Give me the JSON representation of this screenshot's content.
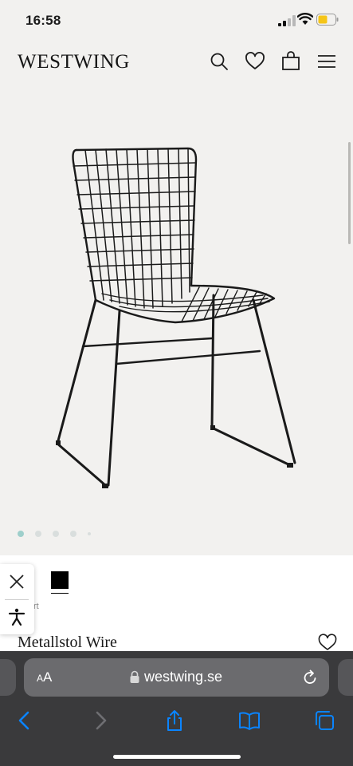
{
  "status_bar": {
    "time": "16:58",
    "battery_color": "#f5c518"
  },
  "header": {
    "logo": "WESTWING",
    "icons": [
      "search-icon",
      "heart-icon",
      "bag-icon",
      "menu-icon"
    ]
  },
  "gallery": {
    "slide_count": 5,
    "active_index": 0,
    "active_color": "#9ecfcb",
    "inactive_color": "#d9dedd"
  },
  "product": {
    "color_label_partial": "rt",
    "selected_swatch_color": "#000000",
    "name": "Metallstol Wire"
  },
  "accessibility_widget": {
    "icons": [
      "close-icon",
      "accessibility-icon"
    ]
  },
  "browser": {
    "text_size_button": "AA",
    "url": "westwing.se",
    "toolbar_icons": [
      "back-icon",
      "forward-icon",
      "share-icon",
      "bookmarks-icon",
      "tabs-icon"
    ],
    "accent_color": "#0a84ff"
  }
}
